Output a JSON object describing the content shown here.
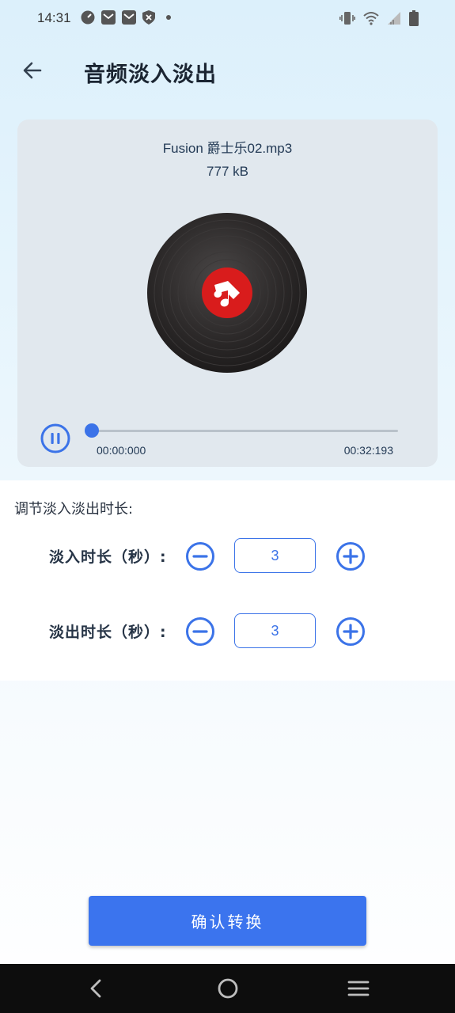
{
  "status_bar": {
    "time": "14:31",
    "left_icons": [
      "speedometer-icon",
      "mail-icon",
      "mail-icon",
      "shield-icon",
      "dot-icon"
    ],
    "right_icons": [
      "vibrate-icon",
      "wifi-icon",
      "signal-icon",
      "battery-icon"
    ]
  },
  "header": {
    "title": "音频淡入淡出",
    "back_icon": "arrow-left-icon"
  },
  "player": {
    "file_name": "Fusion 爵士乐02.mp3",
    "file_size": "777 kB",
    "current_time": "00:00:000",
    "total_time": "00:32:193",
    "progress": 0,
    "state_icon": "pause-icon",
    "accent_color": "#3b73e8"
  },
  "settings": {
    "heading": "调节淡入淡出时长:",
    "fade_in": {
      "label": "淡入时长（秒）:",
      "value": "3"
    },
    "fade_out": {
      "label": "淡出时长（秒）:",
      "value": "3"
    }
  },
  "actions": {
    "confirm_label": "确认转换"
  },
  "nav_bar": {
    "icons": [
      "nav-back-icon",
      "nav-home-icon",
      "nav-recents-icon"
    ]
  }
}
